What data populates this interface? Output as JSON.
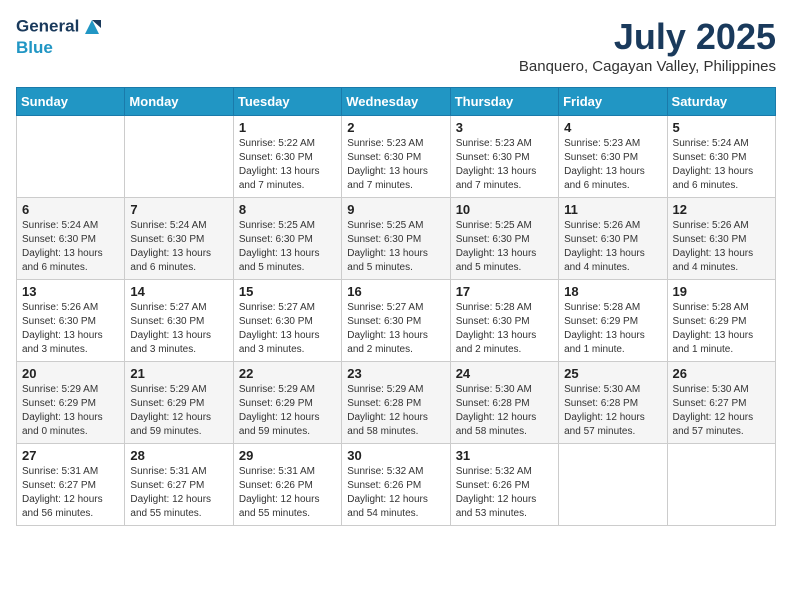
{
  "logo": {
    "line1": "General",
    "line2": "Blue"
  },
  "title": "July 2025",
  "subtitle": "Banquero, Cagayan Valley, Philippines",
  "days_of_week": [
    "Sunday",
    "Monday",
    "Tuesday",
    "Wednesday",
    "Thursday",
    "Friday",
    "Saturday"
  ],
  "weeks": [
    [
      {
        "day": "",
        "detail": ""
      },
      {
        "day": "",
        "detail": ""
      },
      {
        "day": "1",
        "detail": "Sunrise: 5:22 AM\nSunset: 6:30 PM\nDaylight: 13 hours and 7 minutes."
      },
      {
        "day": "2",
        "detail": "Sunrise: 5:23 AM\nSunset: 6:30 PM\nDaylight: 13 hours and 7 minutes."
      },
      {
        "day": "3",
        "detail": "Sunrise: 5:23 AM\nSunset: 6:30 PM\nDaylight: 13 hours and 7 minutes."
      },
      {
        "day": "4",
        "detail": "Sunrise: 5:23 AM\nSunset: 6:30 PM\nDaylight: 13 hours and 6 minutes."
      },
      {
        "day": "5",
        "detail": "Sunrise: 5:24 AM\nSunset: 6:30 PM\nDaylight: 13 hours and 6 minutes."
      }
    ],
    [
      {
        "day": "6",
        "detail": "Sunrise: 5:24 AM\nSunset: 6:30 PM\nDaylight: 13 hours and 6 minutes."
      },
      {
        "day": "7",
        "detail": "Sunrise: 5:24 AM\nSunset: 6:30 PM\nDaylight: 13 hours and 6 minutes."
      },
      {
        "day": "8",
        "detail": "Sunrise: 5:25 AM\nSunset: 6:30 PM\nDaylight: 13 hours and 5 minutes."
      },
      {
        "day": "9",
        "detail": "Sunrise: 5:25 AM\nSunset: 6:30 PM\nDaylight: 13 hours and 5 minutes."
      },
      {
        "day": "10",
        "detail": "Sunrise: 5:25 AM\nSunset: 6:30 PM\nDaylight: 13 hours and 5 minutes."
      },
      {
        "day": "11",
        "detail": "Sunrise: 5:26 AM\nSunset: 6:30 PM\nDaylight: 13 hours and 4 minutes."
      },
      {
        "day": "12",
        "detail": "Sunrise: 5:26 AM\nSunset: 6:30 PM\nDaylight: 13 hours and 4 minutes."
      }
    ],
    [
      {
        "day": "13",
        "detail": "Sunrise: 5:26 AM\nSunset: 6:30 PM\nDaylight: 13 hours and 3 minutes."
      },
      {
        "day": "14",
        "detail": "Sunrise: 5:27 AM\nSunset: 6:30 PM\nDaylight: 13 hours and 3 minutes."
      },
      {
        "day": "15",
        "detail": "Sunrise: 5:27 AM\nSunset: 6:30 PM\nDaylight: 13 hours and 3 minutes."
      },
      {
        "day": "16",
        "detail": "Sunrise: 5:27 AM\nSunset: 6:30 PM\nDaylight: 13 hours and 2 minutes."
      },
      {
        "day": "17",
        "detail": "Sunrise: 5:28 AM\nSunset: 6:30 PM\nDaylight: 13 hours and 2 minutes."
      },
      {
        "day": "18",
        "detail": "Sunrise: 5:28 AM\nSunset: 6:29 PM\nDaylight: 13 hours and 1 minute."
      },
      {
        "day": "19",
        "detail": "Sunrise: 5:28 AM\nSunset: 6:29 PM\nDaylight: 13 hours and 1 minute."
      }
    ],
    [
      {
        "day": "20",
        "detail": "Sunrise: 5:29 AM\nSunset: 6:29 PM\nDaylight: 13 hours and 0 minutes."
      },
      {
        "day": "21",
        "detail": "Sunrise: 5:29 AM\nSunset: 6:29 PM\nDaylight: 12 hours and 59 minutes."
      },
      {
        "day": "22",
        "detail": "Sunrise: 5:29 AM\nSunset: 6:29 PM\nDaylight: 12 hours and 59 minutes."
      },
      {
        "day": "23",
        "detail": "Sunrise: 5:29 AM\nSunset: 6:28 PM\nDaylight: 12 hours and 58 minutes."
      },
      {
        "day": "24",
        "detail": "Sunrise: 5:30 AM\nSunset: 6:28 PM\nDaylight: 12 hours and 58 minutes."
      },
      {
        "day": "25",
        "detail": "Sunrise: 5:30 AM\nSunset: 6:28 PM\nDaylight: 12 hours and 57 minutes."
      },
      {
        "day": "26",
        "detail": "Sunrise: 5:30 AM\nSunset: 6:27 PM\nDaylight: 12 hours and 57 minutes."
      }
    ],
    [
      {
        "day": "27",
        "detail": "Sunrise: 5:31 AM\nSunset: 6:27 PM\nDaylight: 12 hours and 56 minutes."
      },
      {
        "day": "28",
        "detail": "Sunrise: 5:31 AM\nSunset: 6:27 PM\nDaylight: 12 hours and 55 minutes."
      },
      {
        "day": "29",
        "detail": "Sunrise: 5:31 AM\nSunset: 6:26 PM\nDaylight: 12 hours and 55 minutes."
      },
      {
        "day": "30",
        "detail": "Sunrise: 5:32 AM\nSunset: 6:26 PM\nDaylight: 12 hours and 54 minutes."
      },
      {
        "day": "31",
        "detail": "Sunrise: 5:32 AM\nSunset: 6:26 PM\nDaylight: 12 hours and 53 minutes."
      },
      {
        "day": "",
        "detail": ""
      },
      {
        "day": "",
        "detail": ""
      }
    ]
  ]
}
